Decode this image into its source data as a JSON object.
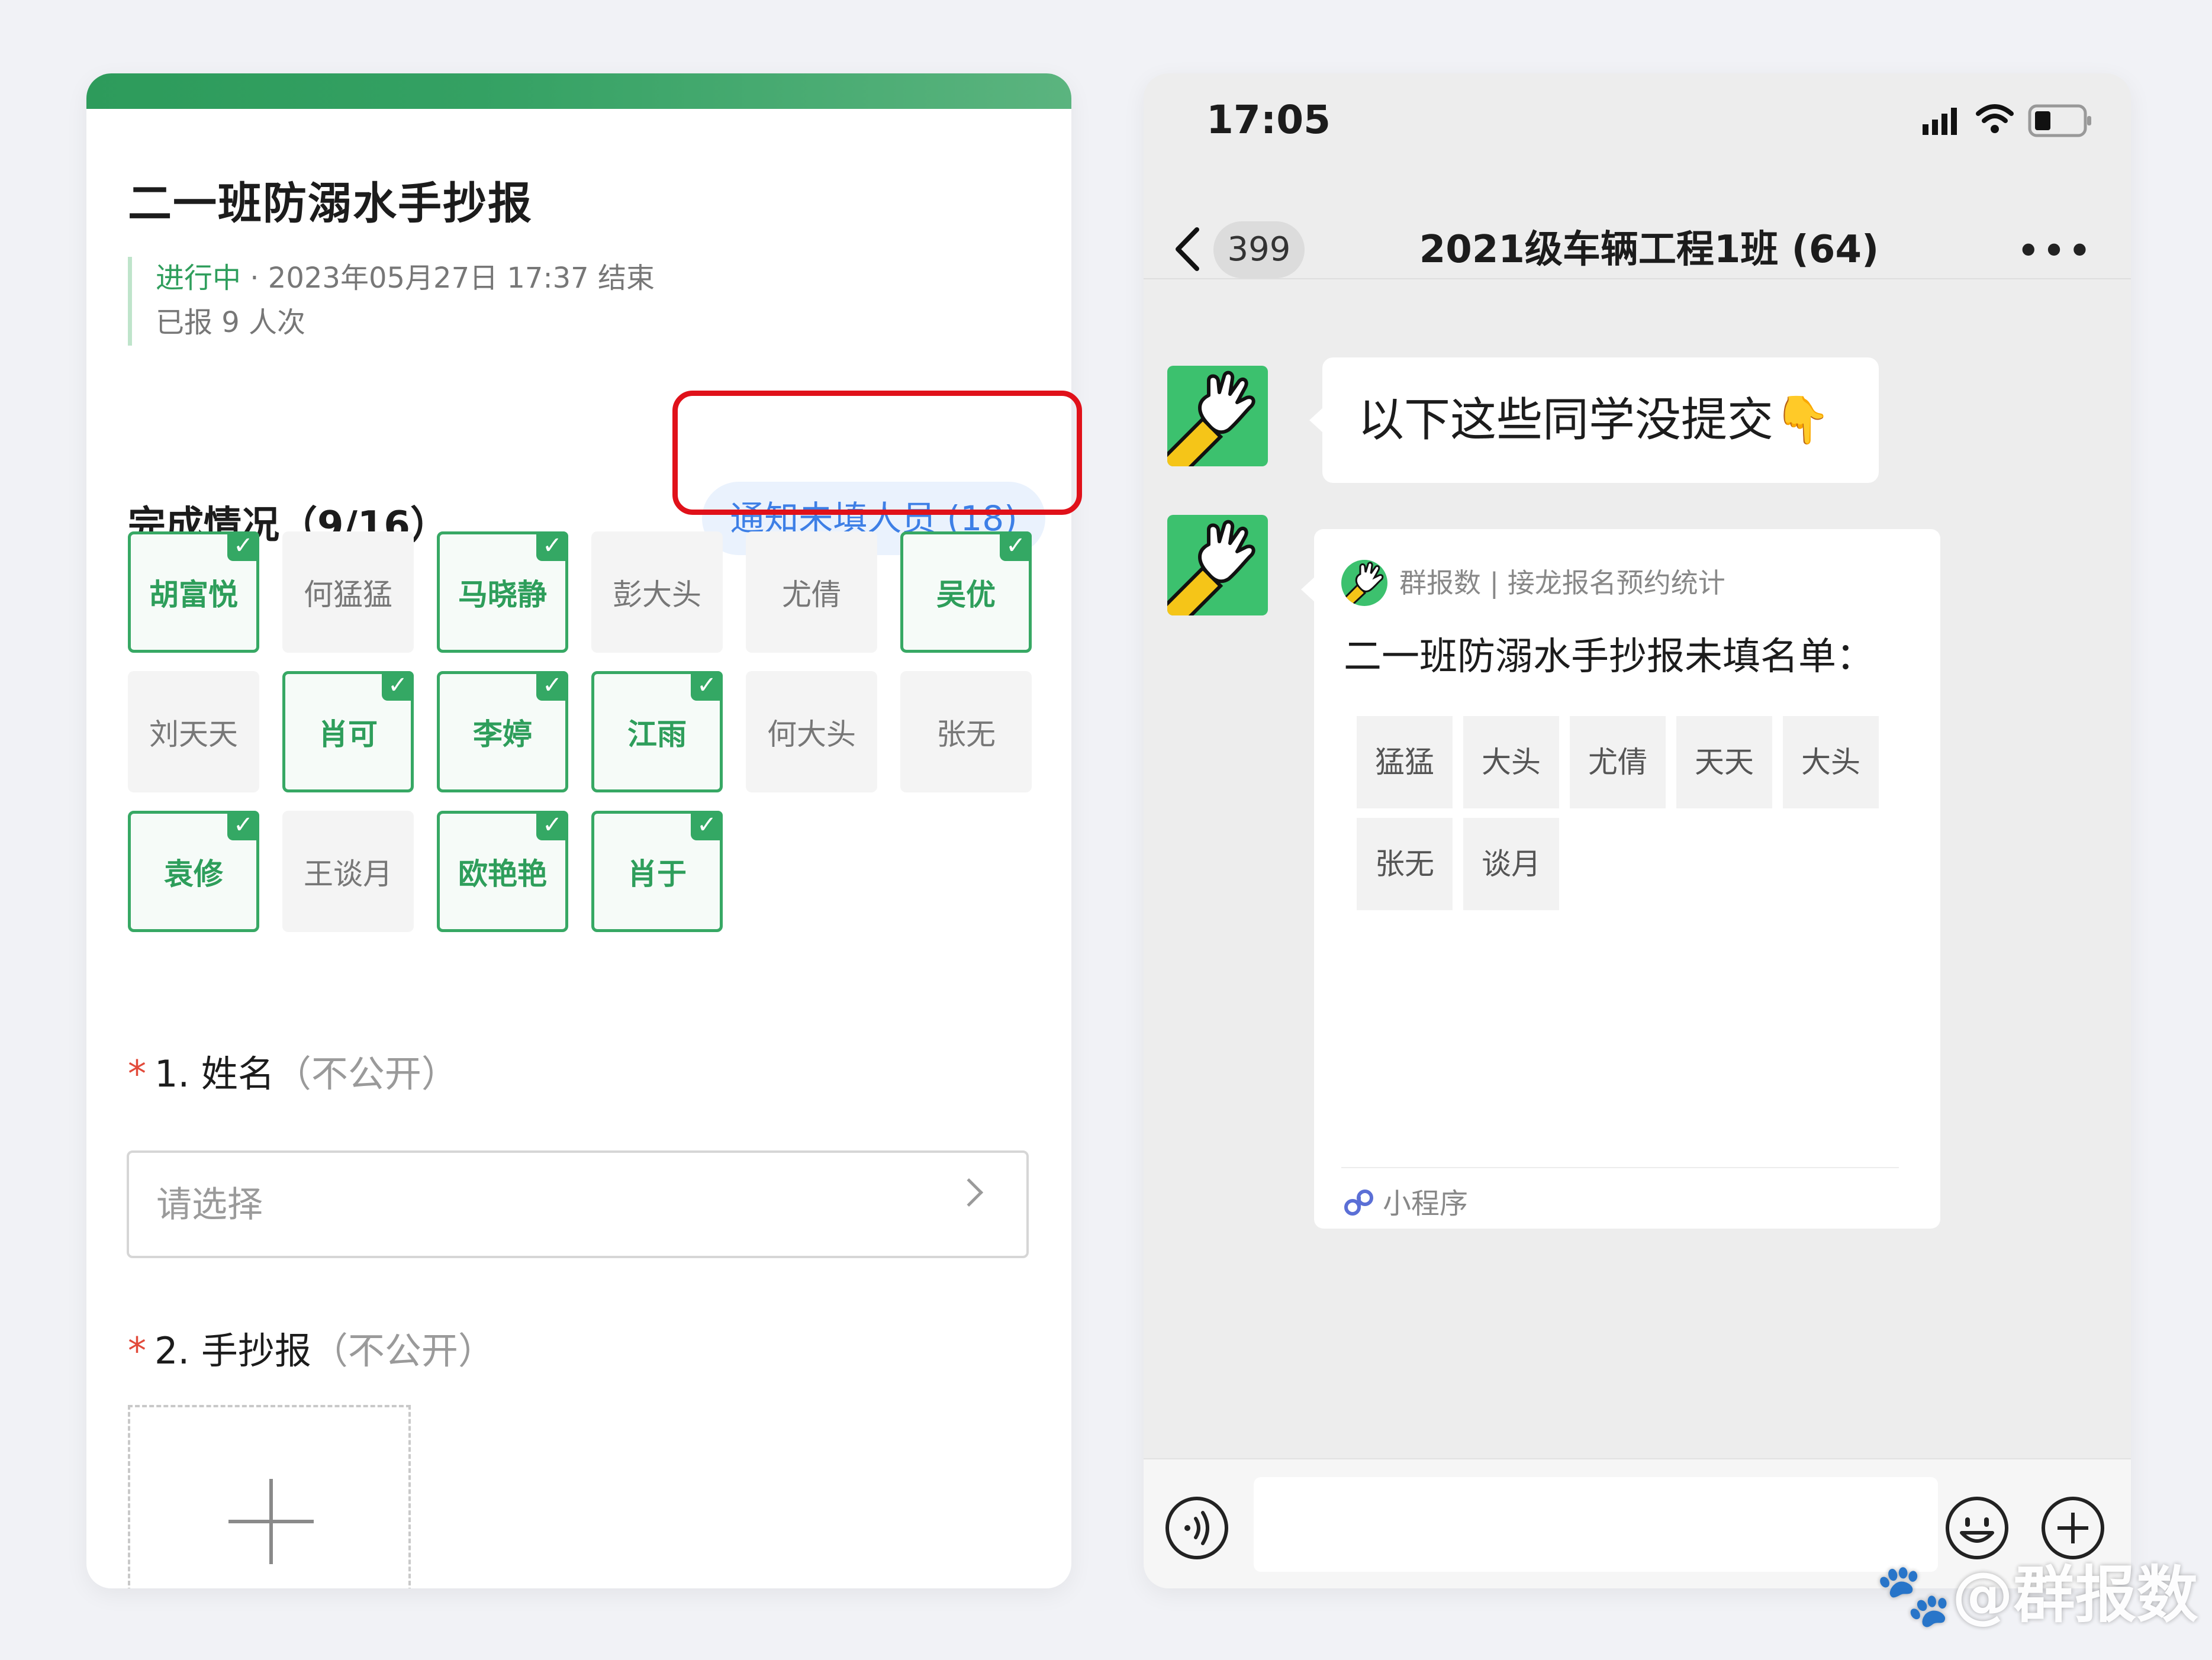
{
  "form": {
    "title": "二一班防溺水手抄报",
    "status_label": "进行中",
    "status_detail": " · 2023年05月27日 17:37 结束",
    "reported": "已报 9 人次",
    "progress_title": "完成情况（9/16）",
    "notify_button": "通知未填人员 (18)",
    "students": [
      {
        "name": "胡富悦",
        "done": true
      },
      {
        "name": "何猛猛",
        "done": false
      },
      {
        "name": "马晓静",
        "done": true
      },
      {
        "name": "彭大头",
        "done": false
      },
      {
        "name": "尤倩",
        "done": false
      },
      {
        "name": "吴优",
        "done": true
      },
      {
        "name": "刘天天",
        "done": false
      },
      {
        "name": "肖可",
        "done": true
      },
      {
        "name": "李婷",
        "done": true
      },
      {
        "name": "江雨",
        "done": true
      },
      {
        "name": "何大头",
        "done": false
      },
      {
        "name": "张无",
        "done": false
      },
      {
        "name": "袁修",
        "done": true
      },
      {
        "name": "王谈月",
        "done": false
      },
      {
        "name": "欧艳艳",
        "done": true
      },
      {
        "name": "肖于",
        "done": true
      }
    ],
    "check_mark": "✓",
    "questions": [
      {
        "required_mark": "*",
        "label": "1. 姓名",
        "note": "（不公开）"
      },
      {
        "required_mark": "*",
        "label": "2. 手抄报",
        "note": "（不公开）"
      }
    ],
    "select_placeholder": "请选择"
  },
  "phone": {
    "time": "17:05",
    "back_badge": "399",
    "chat_title": "2021级车辆工程1班 (64)",
    "more": "•••",
    "message1": "以下这些同学没提交👇",
    "card": {
      "app": "群报数 | 接龙报名预约统计",
      "title": "二一班防溺水手抄报未填名单：",
      "names": [
        "猛猛",
        "大头",
        "尤倩",
        "天天",
        "大头",
        "张无",
        "谈月"
      ],
      "footer": "小程序"
    }
  },
  "watermark": "🐾@群报数",
  "colors": {
    "accent_green": "#34a864",
    "notify_blue": "#3d7fe6",
    "highlight_red": "#e0111a",
    "avatar_green": "#3cc16e"
  }
}
